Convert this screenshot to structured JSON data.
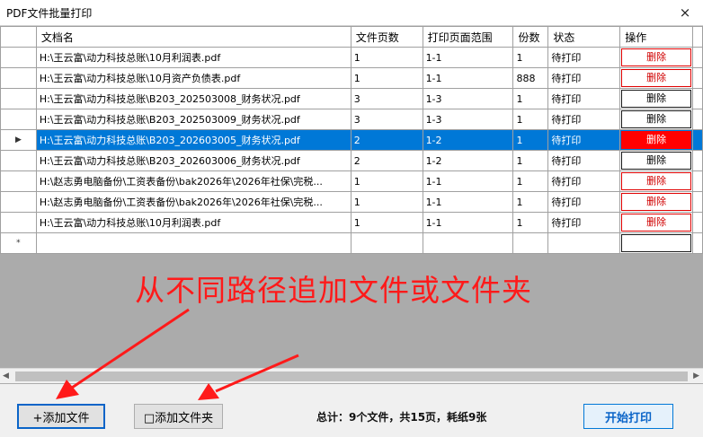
{
  "window": {
    "title": "PDF文件批量打印",
    "close_icon": "×"
  },
  "table": {
    "headers": [
      "文档名",
      "文件页数",
      "打印页面范围",
      "份数",
      "状态",
      "操作"
    ],
    "rows": [
      {
        "name": "H:\\王云富\\动力科技总账\\10月利润表.pdf",
        "pages": "1",
        "range": "1-1",
        "copies": "1",
        "status": "待打印",
        "action": "删除"
      },
      {
        "name": "H:\\王云富\\动力科技总账\\10月资产负债表.pdf",
        "pages": "1",
        "range": "1-1",
        "copies": "888",
        "status": "待打印",
        "action": "删除"
      },
      {
        "name": "H:\\王云富\\动力科技总账\\B203_202503008_财务状况.pdf",
        "pages": "3",
        "range": "1-3",
        "copies": "1",
        "status": "待打印",
        "action": "删除"
      },
      {
        "name": "H:\\王云富\\动力科技总账\\B203_202503009_财务状况.pdf",
        "pages": "3",
        "range": "1-3",
        "copies": "1",
        "status": "待打印",
        "action": "删除"
      },
      {
        "name": "H:\\王云富\\动力科技总账\\B203_202603005_财务状况.pdf",
        "pages": "2",
        "range": "1-2",
        "copies": "1",
        "status": "待打印",
        "action": "删除"
      },
      {
        "name": "H:\\王云富\\动力科技总账\\B203_202603006_财务状况.pdf",
        "pages": "2",
        "range": "1-2",
        "copies": "1",
        "status": "待打印",
        "action": "删除"
      },
      {
        "name": "H:\\赵志勇电脑备份\\工资表备份\\bak2026年\\2026年社保\\完税...",
        "pages": "1",
        "range": "1-1",
        "copies": "1",
        "status": "待打印",
        "action": "删除"
      },
      {
        "name": "H:\\赵志勇电脑备份\\工资表备份\\bak2026年\\2026年社保\\完税...",
        "pages": "1",
        "range": "1-1",
        "copies": "1",
        "status": "待打印",
        "action": "删除"
      },
      {
        "name": "H:\\王云富\\动力科技总账\\10月利润表.pdf",
        "pages": "1",
        "range": "1-1",
        "copies": "1",
        "status": "待打印",
        "action": "删除"
      }
    ],
    "current_row_marker": "▶",
    "new_row_marker": "*"
  },
  "annotation": {
    "text": "从不同路径追加文件或文件夹",
    "color": "#ff1a1a"
  },
  "buttons": {
    "add_file": "+添加文件",
    "add_folder": "□添加文件夹",
    "start_print": "开始打印"
  },
  "summary": "总计：9个文件，共15页，耗纸9张",
  "colors": {
    "selection": "#0078d7",
    "delete_red": "#ff0000",
    "grid_bg": "#ababab"
  }
}
